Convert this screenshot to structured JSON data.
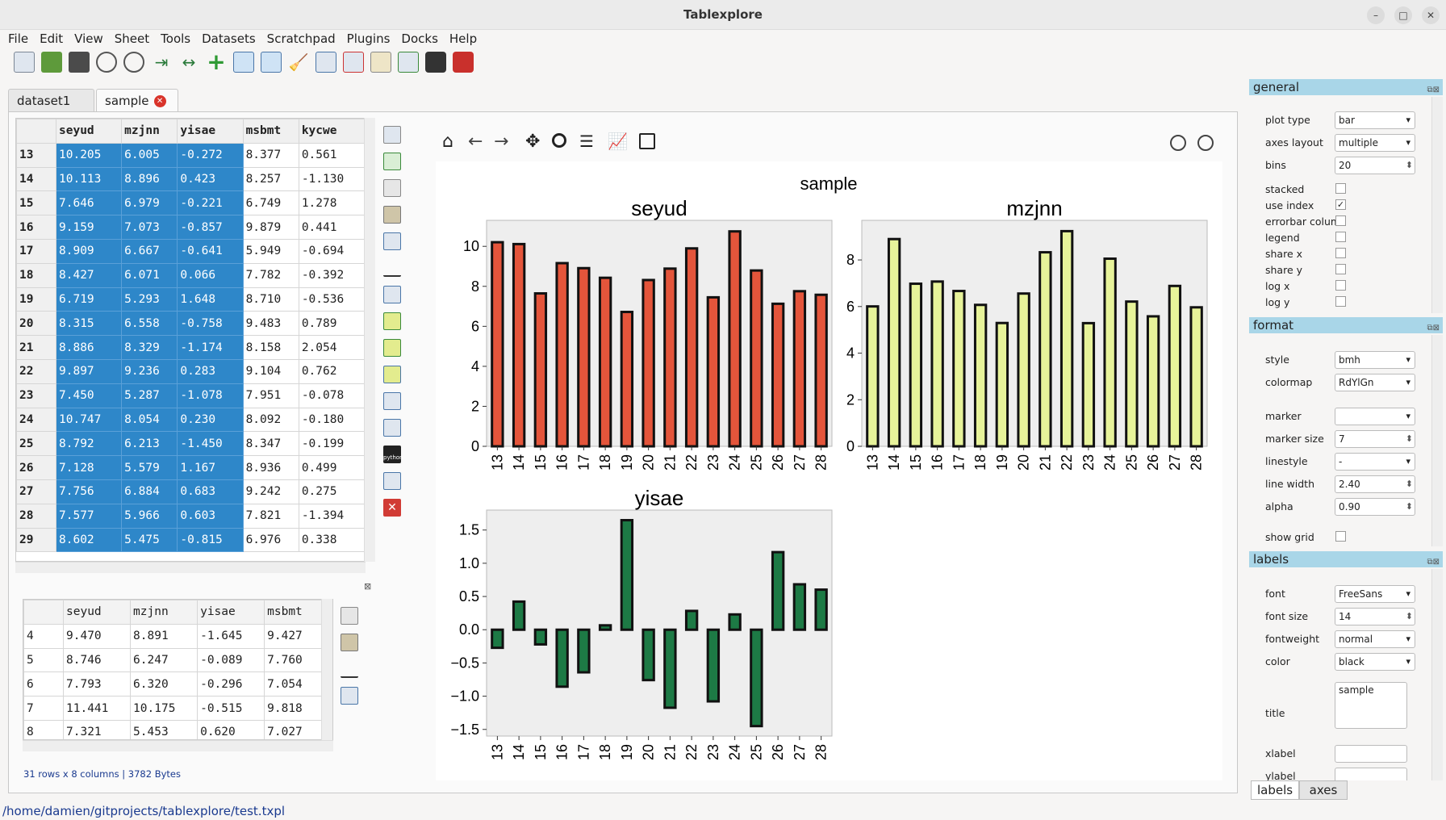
{
  "window": {
    "title": "Tablexplore",
    "minimize": "–",
    "maximize": "□",
    "close": "✕"
  },
  "menu": [
    "File",
    "Edit",
    "View",
    "Sheet",
    "Tools",
    "Datasets",
    "Scratchpad",
    "Plugins",
    "Docks",
    "Help"
  ],
  "tabs": [
    {
      "label": "dataset1"
    },
    {
      "label": "sample"
    }
  ],
  "main_table": {
    "columns": [
      "seyud",
      "mzjnn",
      "yisae",
      "msbmt",
      "kycwe"
    ],
    "rows": [
      [
        "13",
        "10.205",
        "6.005",
        "-0.272",
        "8.377",
        "0.561"
      ],
      [
        "14",
        "10.113",
        "8.896",
        "0.423",
        "8.257",
        "-1.130"
      ],
      [
        "15",
        "7.646",
        "6.979",
        "-0.221",
        "6.749",
        "1.278"
      ],
      [
        "16",
        "9.159",
        "7.073",
        "-0.857",
        "9.879",
        "0.441"
      ],
      [
        "17",
        "8.909",
        "6.667",
        "-0.641",
        "5.949",
        "-0.694"
      ],
      [
        "18",
        "8.427",
        "6.071",
        "0.066",
        "7.782",
        "-0.392"
      ],
      [
        "19",
        "6.719",
        "5.293",
        "1.648",
        "8.710",
        "-0.536"
      ],
      [
        "20",
        "8.315",
        "6.558",
        "-0.758",
        "9.483",
        "0.789"
      ],
      [
        "21",
        "8.886",
        "8.329",
        "-1.174",
        "8.158",
        "2.054"
      ],
      [
        "22",
        "9.897",
        "9.236",
        "0.283",
        "9.104",
        "0.762"
      ],
      [
        "23",
        "7.450",
        "5.287",
        "-1.078",
        "7.951",
        "-0.078"
      ],
      [
        "24",
        "10.747",
        "8.054",
        "0.230",
        "8.092",
        "-0.180"
      ],
      [
        "25",
        "8.792",
        "6.213",
        "-1.450",
        "8.347",
        "-0.199"
      ],
      [
        "26",
        "7.128",
        "5.579",
        "1.167",
        "8.936",
        "0.499"
      ],
      [
        "27",
        "7.756",
        "6.884",
        "0.683",
        "9.242",
        "0.275"
      ],
      [
        "28",
        "7.577",
        "5.966",
        "0.603",
        "7.821",
        "-1.394"
      ],
      [
        "29",
        "8.602",
        "5.475",
        "-0.815",
        "6.976",
        "0.338"
      ]
    ]
  },
  "sub_table": {
    "columns": [
      "seyud",
      "mzjnn",
      "yisae",
      "msbmt"
    ],
    "rows": [
      [
        "4",
        "9.470",
        "8.891",
        "-1.645",
        "9.427"
      ],
      [
        "5",
        "8.746",
        "6.247",
        "-0.089",
        "7.760"
      ],
      [
        "6",
        "7.793",
        "6.320",
        "-0.296",
        "7.054"
      ],
      [
        "7",
        "11.441",
        "10.175",
        "-0.515",
        "9.818"
      ],
      [
        "8",
        "7.321",
        "5.453",
        "0.620",
        "7.027"
      ]
    ]
  },
  "table_info": "31 rows x 8 columns | 3782 Bytes",
  "statusbar": "/home/damien/gitprojects/tablexplore/test.txpl",
  "chart_data": [
    {
      "type": "bar",
      "title": "seyud",
      "categories": [
        "13",
        "14",
        "15",
        "16",
        "17",
        "18",
        "19",
        "20",
        "21",
        "22",
        "23",
        "24",
        "25",
        "26",
        "27",
        "28"
      ],
      "values": [
        10.205,
        10.113,
        7.646,
        9.159,
        8.909,
        8.427,
        6.719,
        8.315,
        8.886,
        9.897,
        7.45,
        10.747,
        8.792,
        7.128,
        7.756,
        7.577
      ],
      "ylim": [
        0,
        11.3
      ],
      "yticks": [
        "0",
        "2",
        "4",
        "6",
        "8",
        "10"
      ],
      "color": "#e4553b"
    },
    {
      "type": "bar",
      "title": "mzjnn",
      "categories": [
        "13",
        "14",
        "15",
        "16",
        "17",
        "18",
        "19",
        "20",
        "21",
        "22",
        "23",
        "24",
        "25",
        "26",
        "27",
        "28"
      ],
      "values": [
        6.005,
        8.896,
        6.979,
        7.073,
        6.667,
        6.071,
        5.293,
        6.558,
        8.329,
        9.236,
        5.287,
        8.054,
        6.213,
        5.579,
        6.884,
        5.966
      ],
      "ylim": [
        0,
        9.7
      ],
      "yticks": [
        "0",
        "2",
        "4",
        "6",
        "8"
      ],
      "color": "#e7f39a"
    },
    {
      "type": "bar",
      "title": "yisae",
      "categories": [
        "13",
        "14",
        "15",
        "16",
        "17",
        "18",
        "19",
        "20",
        "21",
        "22",
        "23",
        "24",
        "25",
        "26",
        "27",
        "28"
      ],
      "values": [
        -0.272,
        0.423,
        -0.221,
        -0.857,
        -0.641,
        0.066,
        1.648,
        -0.758,
        -1.174,
        0.283,
        -1.078,
        0.23,
        -1.45,
        1.167,
        0.683,
        0.603
      ],
      "ylim": [
        -1.6,
        1.8
      ],
      "yticks": [
        "−1.5",
        "−1.0",
        "−0.5",
        "0.0",
        "0.5",
        "1.0",
        "1.5"
      ],
      "color": "#1d7a45"
    }
  ],
  "figure_title": "sample",
  "general": {
    "header": "general",
    "rows": [
      {
        "label": "plot type",
        "kind": "combo",
        "value": "bar"
      },
      {
        "label": "axes layout",
        "kind": "combo",
        "value": "multiple"
      },
      {
        "label": "bins",
        "kind": "spin",
        "value": "20"
      },
      {
        "label": "stacked",
        "kind": "chk",
        "value": ""
      },
      {
        "label": "use index",
        "kind": "chk",
        "value": "✓"
      },
      {
        "label": "errorbar colum",
        "kind": "chk",
        "value": ""
      },
      {
        "label": "legend",
        "kind": "chk",
        "value": ""
      },
      {
        "label": "share x",
        "kind": "chk",
        "value": ""
      },
      {
        "label": "share y",
        "kind": "chk",
        "value": ""
      },
      {
        "label": "log x",
        "kind": "chk",
        "value": ""
      },
      {
        "label": "log y",
        "kind": "chk",
        "value": ""
      }
    ]
  },
  "format": {
    "header": "format",
    "rows": [
      {
        "label": "style",
        "kind": "combo",
        "value": "bmh"
      },
      {
        "label": "colormap",
        "kind": "combo",
        "value": "RdYlGn"
      },
      {
        "label": "marker",
        "kind": "combo",
        "value": ""
      },
      {
        "label": "marker size",
        "kind": "spin",
        "value": "7"
      },
      {
        "label": "linestyle",
        "kind": "combo",
        "value": "-"
      },
      {
        "label": "line width",
        "kind": "spin",
        "value": "2.40"
      },
      {
        "label": "alpha",
        "kind": "spin",
        "value": "0.90"
      },
      {
        "label": "show grid",
        "kind": "chk",
        "value": ""
      }
    ]
  },
  "labels": {
    "header": "labels",
    "rows": [
      {
        "label": "font",
        "kind": "combo",
        "value": "FreeSans"
      },
      {
        "label": "font size",
        "kind": "spin",
        "value": "14"
      },
      {
        "label": "fontweight",
        "kind": "combo",
        "value": "normal"
      },
      {
        "label": "color",
        "kind": "combo",
        "value": "black"
      },
      {
        "label": "title",
        "kind": "text",
        "value": "sample"
      },
      {
        "label": "xlabel",
        "kind": "text",
        "value": ""
      },
      {
        "label": "ylabel",
        "kind": "text",
        "value": ""
      }
    ]
  },
  "dock_tabs": [
    "labels",
    "axes"
  ]
}
